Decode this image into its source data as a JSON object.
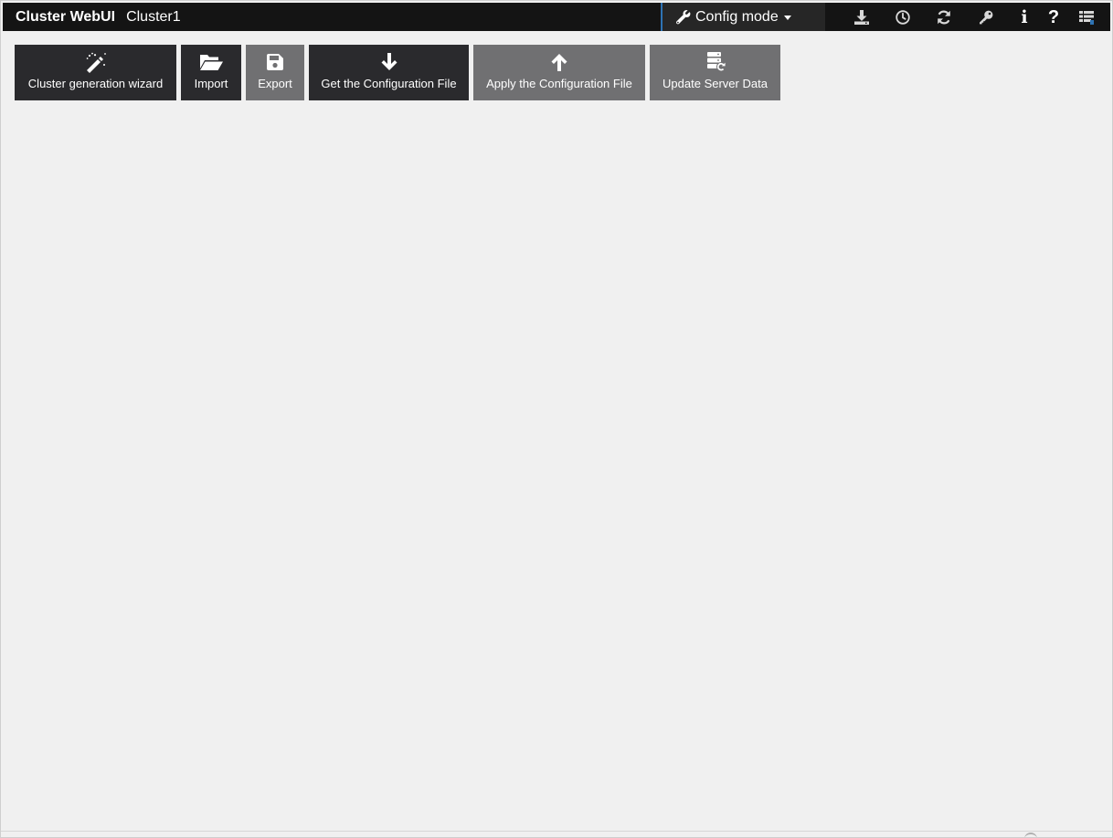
{
  "header": {
    "app_title": "Cluster WebUI",
    "cluster_name": "Cluster1",
    "mode_label": "Config mode",
    "icons": [
      "wrench-icon",
      "download-icon",
      "clock-icon",
      "refresh-icon",
      "key-icon",
      "info-icon",
      "help-icon",
      "list-icon"
    ],
    "info_glyph": "i",
    "help_glyph": "?"
  },
  "toolbar": {
    "buttons": [
      {
        "label": "Cluster generation wizard",
        "icon": "magic-wand-icon",
        "style": "dark"
      },
      {
        "label": "Import",
        "icon": "folder-open-icon",
        "style": "dark"
      },
      {
        "label": "Export",
        "icon": "save-icon",
        "style": "gray"
      },
      {
        "label": "Get the Configuration File",
        "icon": "arrow-down-icon",
        "style": "dark"
      },
      {
        "label": "Apply the Configuration File",
        "icon": "arrow-up-icon",
        "style": "gray"
      },
      {
        "label": "Update Server Data",
        "icon": "server-refresh-icon",
        "style": "gray"
      }
    ]
  },
  "colors": {
    "header_bg": "#141414",
    "mode_bg": "#262626",
    "mode_accent": "#2e73b4",
    "button_dark": "#2a2a2d",
    "button_gray": "#707072",
    "page_bg": "#f0f0f0"
  }
}
